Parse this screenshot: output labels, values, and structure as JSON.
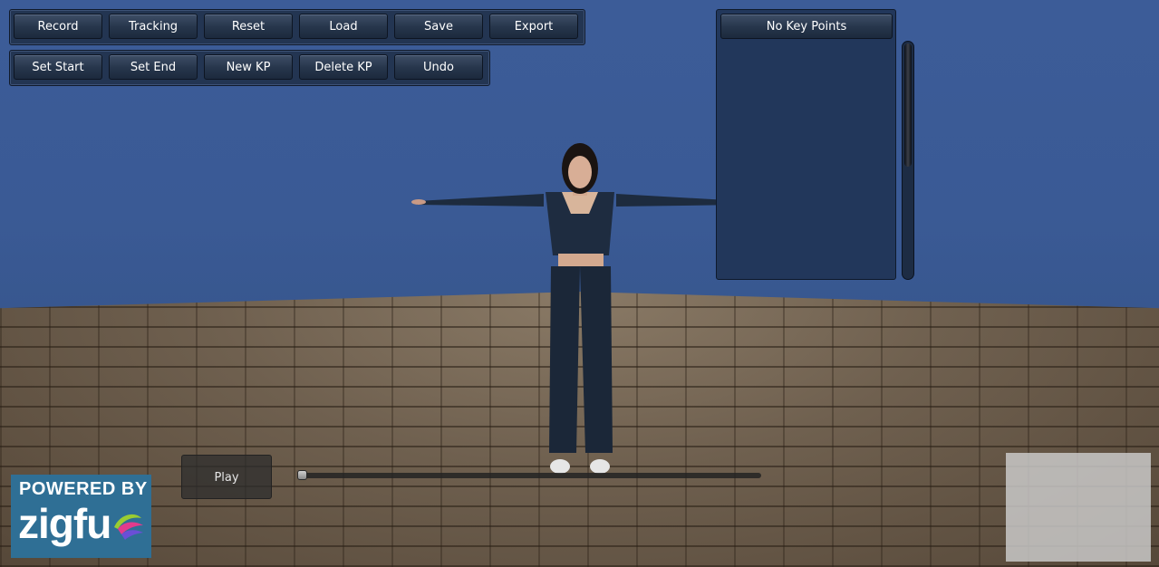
{
  "toolbar_row1": [
    "Record",
    "Tracking",
    "Reset",
    "Load",
    "Save",
    "Export"
  ],
  "toolbar_row2": [
    "Set Start",
    "Set End",
    "New KP",
    "Delete KP",
    "Undo"
  ],
  "keypoints_panel": {
    "header": "No Key Points"
  },
  "playback": {
    "play_label": "Play",
    "timeline_position": 0.0
  },
  "logo": {
    "top_text": "POWERED BY",
    "word": "zigfu"
  },
  "colors": {
    "sky": "#3a5a95",
    "toolbar_bg": "#233552",
    "panel_bg": "#22375b",
    "logo_bg": "#2f6f95"
  }
}
